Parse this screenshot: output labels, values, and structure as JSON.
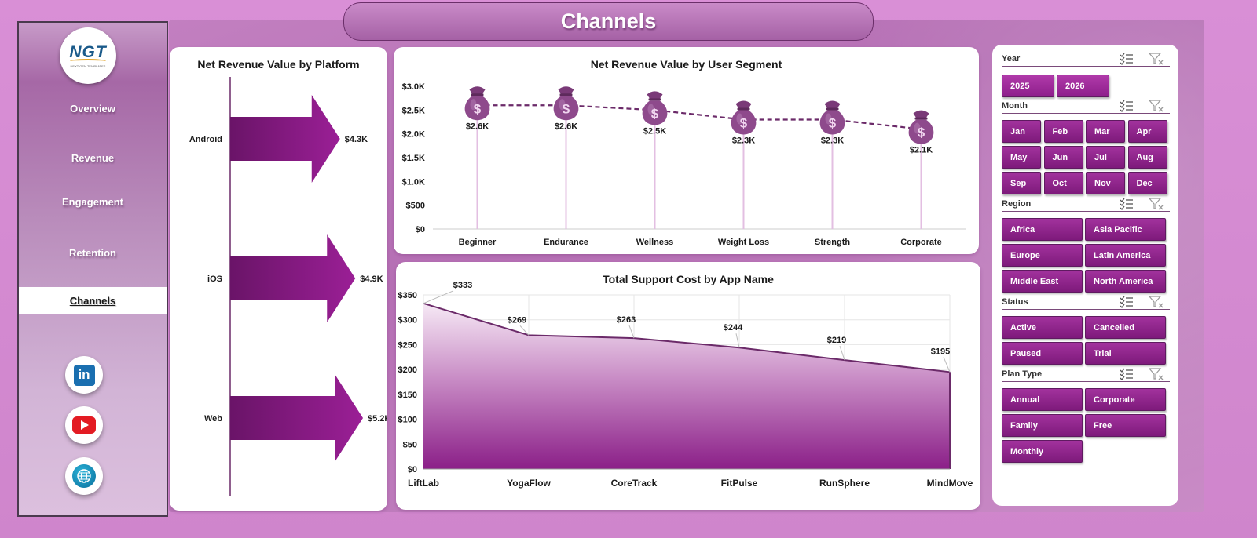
{
  "page": {
    "title": "Channels"
  },
  "brand": {
    "logo_text": "NGT",
    "logo_sub": "NEXT GEN TEMPLATES"
  },
  "nav": {
    "items": [
      {
        "label": "Overview",
        "active": false
      },
      {
        "label": "Revenue",
        "active": false
      },
      {
        "label": "Engagement",
        "active": false
      },
      {
        "label": "Retention",
        "active": false
      },
      {
        "label": "Channels",
        "active": true
      }
    ]
  },
  "social": {
    "linkedin": "in",
    "youtube": "youtube-icon",
    "web": "globe-icon"
  },
  "colors": {
    "accent": "#9b1f96",
    "accent_dark": "#6a1468",
    "line": "#6b2a69",
    "bag": "#8e4a8c"
  },
  "chart_data": [
    {
      "type": "bar",
      "title": "Net Revenue  Value  by Platform",
      "categories": [
        "Android",
        "iOS",
        "Web"
      ],
      "values": [
        4300,
        4900,
        5200
      ],
      "data_labels": [
        "$4.3K",
        "$4.9K",
        "$5.2K"
      ],
      "orientation": "horizontal-arrow",
      "xlim": [
        0,
        6000
      ]
    },
    {
      "type": "line",
      "title": "Net Revenue  Value  by User Segment",
      "categories": [
        "Beginner",
        "Endurance",
        "Wellness",
        "Weight Loss",
        "Strength",
        "Corporate"
      ],
      "values": [
        2600,
        2600,
        2500,
        2300,
        2300,
        2100
      ],
      "data_labels": [
        "$2.6K",
        "$2.6K",
        "$2.5K",
        "$2.3K",
        "$2.3K",
        "$2.1K"
      ],
      "ylim": [
        0,
        3000
      ],
      "yticks": [
        "$0",
        "$500",
        "$1.0K",
        "$1.5K",
        "$2.0K",
        "$2.5K",
        "$3.0K"
      ],
      "marker": "money-bag-icon",
      "line_style": "dashed"
    },
    {
      "type": "area",
      "title": "Total Support Cost by App Name",
      "categories": [
        "LiftLab",
        "YogaFlow",
        "CoreTrack",
        "FitPulse",
        "RunSphere",
        "MindMove"
      ],
      "values": [
        333,
        269,
        263,
        244,
        219,
        195
      ],
      "data_labels": [
        "$333",
        "$269",
        "$263",
        "$244",
        "$219",
        "$195"
      ],
      "ylim": [
        0,
        350
      ],
      "yticks": [
        "$0",
        "$50",
        "$100",
        "$150",
        "$200",
        "$250",
        "$300",
        "$350"
      ],
      "grid": true
    }
  ],
  "filters": {
    "year": {
      "label": "Year",
      "options": [
        "2025",
        "2026"
      ]
    },
    "month": {
      "label": "Month",
      "options": [
        "Jan",
        "Feb",
        "Mar",
        "Apr",
        "May",
        "Jun",
        "Jul",
        "Aug",
        "Sep",
        "Oct",
        "Nov",
        "Dec"
      ]
    },
    "region": {
      "label": "Region",
      "options": [
        "Africa",
        "Asia Pacific",
        "Europe",
        "Latin America",
        "Middle East",
        "North America"
      ]
    },
    "status": {
      "label": "Status",
      "options": [
        "Active",
        "Cancelled",
        "Paused",
        "Trial"
      ]
    },
    "plan_type": {
      "label": "Plan Type",
      "options": [
        "Annual",
        "Corporate",
        "Family",
        "Free",
        "Monthly"
      ]
    }
  }
}
